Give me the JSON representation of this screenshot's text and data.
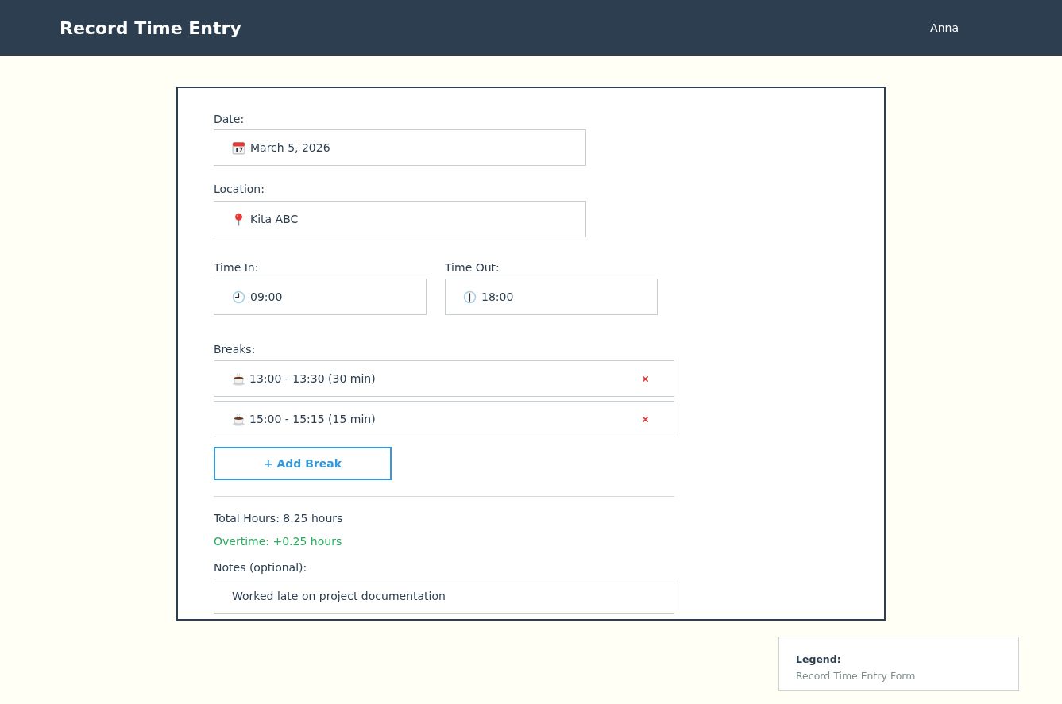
{
  "header": {
    "title": "Record Time Entry",
    "user": "Anna"
  },
  "form": {
    "fields": [
      {
        "kind": "date",
        "label": "Date:",
        "value": "March 5, 2026"
      },
      {
        "kind": "location",
        "label": "Location:",
        "value": "Kita ABC"
      }
    ],
    "time_fields": [
      {
        "kind": "time",
        "label": "Time In:",
        "value": "09:00"
      },
      {
        "kind": "time",
        "label": "Time Out:",
        "value": "18:00"
      }
    ],
    "breaks": {
      "label": "Breaks:",
      "items": [
        {
          "text": "13:00 - 13:30 (30 min)"
        },
        {
          "text": "15:00 - 15:15 (15 min)"
        }
      ],
      "add_button": "+ Add Break"
    },
    "total_hours": "Total Hours: 8.25 hours",
    "overtime": "Overtime: +0.25 hours",
    "notes": {
      "label": "Notes (optional):",
      "value": "Worked late on project documentation"
    }
  },
  "legend": {
    "title": "Legend:",
    "text": "Record Time Entry Form"
  }
}
